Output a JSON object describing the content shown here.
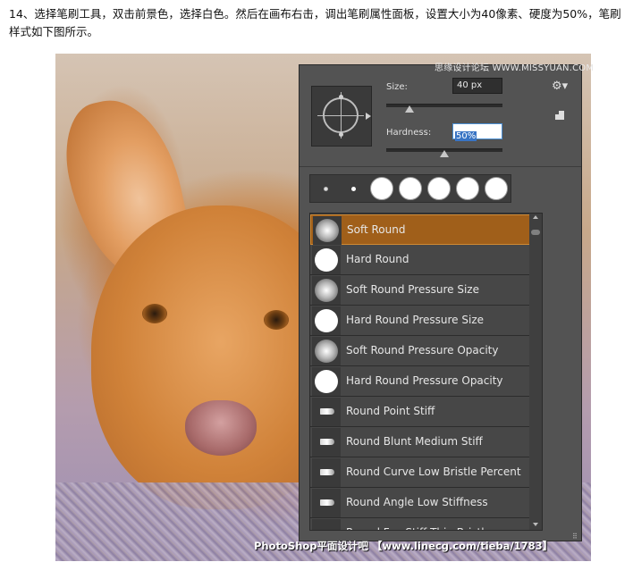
{
  "instruction": "14、选择笔刷工具，双击前景色，选择白色。然后在画布右击，调出笔刷属性面板，设置大小为40像素、硬度为50%，笔刷样式如下图所示。",
  "watermark_top": "思缘设计论坛  WWW.MISSYUAN.COM",
  "watermark_bottom": "PhotoShop平面设计吧  【www.linecg.com/tieba/1783】",
  "brush_panel": {
    "size_label": "Size:",
    "size_value": "40 px",
    "size_level": 0.1,
    "hardness_label": "Hardness:",
    "hardness_value": "50%",
    "hardness_level": 0.5,
    "gear_icon": "gear-icon",
    "new_preset_icon": "new-preset-icon",
    "presets": [
      "soft-small",
      "hard-small",
      "hard-large",
      "hard-large",
      "hard-large",
      "hard-large",
      "hard-large"
    ],
    "brushes": [
      {
        "label": "Soft Round",
        "thumb": "soft",
        "selected": true
      },
      {
        "label": "Hard Round",
        "thumb": "hard"
      },
      {
        "label": "Soft Round Pressure Size",
        "thumb": "soft"
      },
      {
        "label": "Hard Round Pressure Size",
        "thumb": "hard"
      },
      {
        "label": "Soft Round Pressure Opacity",
        "thumb": "soft"
      },
      {
        "label": "Hard Round Pressure Opacity",
        "thumb": "hard"
      },
      {
        "label": "Round Point Stiff",
        "thumb": "bristle"
      },
      {
        "label": "Round Blunt Medium Stiff",
        "thumb": "bristle"
      },
      {
        "label": "Round Curve Low Bristle Percent",
        "thumb": "bristle"
      },
      {
        "label": "Round Angle Low Stiffness",
        "thumb": "bristle"
      },
      {
        "label": "Round Fan Stiff Thin Bristles",
        "thumb": "bristle"
      }
    ]
  },
  "colors": {
    "panel_bg": "#535353",
    "selected_row": "#a05f1a",
    "hardness_highlight": "#3874c4"
  }
}
